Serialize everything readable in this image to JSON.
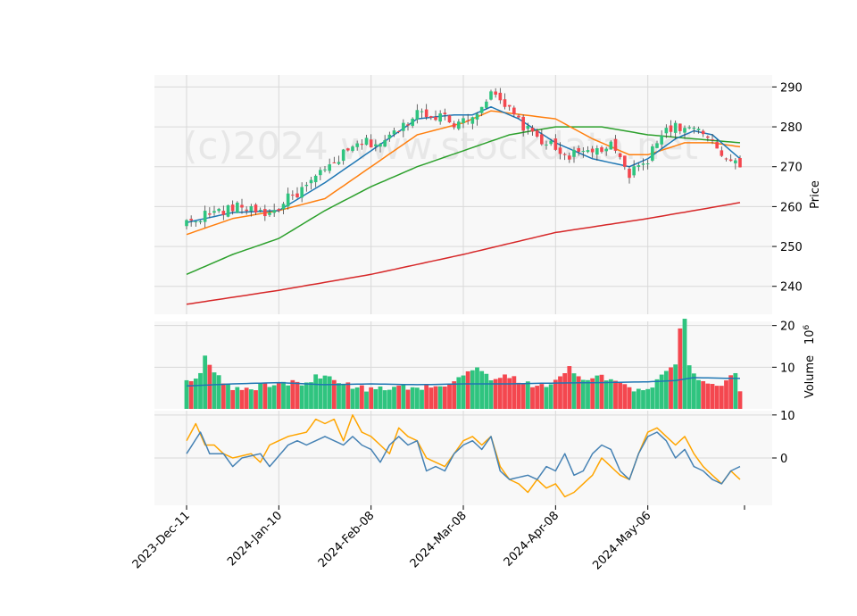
{
  "watermark": "(c)2024 www.stockdata.net",
  "colors": {
    "panel_bg": "#f8f8f8",
    "grid": "#d9d9d9",
    "up": "#2fc47f",
    "down": "#f4474f",
    "ma_short": "#1f77b4",
    "ma_mid": "#ff7f0e",
    "ma_long": "#2ca02c",
    "ma_200": "#d62728",
    "vol_ma": "#1f77b4",
    "osc_main": "#4682b4",
    "osc_signal": "#ffa500"
  },
  "chart_data": [
    {
      "type": "candlestick",
      "panel": "price",
      "ylabel": "Price",
      "ylim": [
        233,
        293
      ],
      "yticks": [
        "240",
        "250",
        "260",
        "270",
        "280",
        "290"
      ],
      "x_tick_labels": [
        "2023-Dec-11",
        "2024-Jan-10",
        "2024-Feb-08",
        "2024-Mar-08",
        "2024-Apr-08",
        "2024-May-06"
      ],
      "x_tick_positions": [
        0,
        20,
        40,
        60,
        80,
        100
      ],
      "n_bars": 121,
      "close_key": [
        [
          0,
          256
        ],
        [
          4,
          258
        ],
        [
          8,
          259
        ],
        [
          12,
          260
        ],
        [
          16,
          259
        ],
        [
          18,
          258
        ],
        [
          22,
          262
        ],
        [
          26,
          265
        ],
        [
          30,
          269
        ],
        [
          34,
          273
        ],
        [
          38,
          276
        ],
        [
          42,
          276
        ],
        [
          46,
          279
        ],
        [
          50,
          284
        ],
        [
          54,
          283
        ],
        [
          58,
          281
        ],
        [
          62,
          283
        ],
        [
          66,
          288
        ],
        [
          70,
          284
        ],
        [
          74,
          279
        ],
        [
          78,
          276
        ],
        [
          82,
          273
        ],
        [
          84,
          273
        ],
        [
          88,
          274
        ],
        [
          92,
          275
        ],
        [
          96,
          268
        ],
        [
          100,
          272
        ],
        [
          104,
          280
        ],
        [
          108,
          280
        ],
        [
          112,
          278
        ],
        [
          116,
          273
        ],
        [
          118,
          272
        ],
        [
          120,
          271
        ]
      ],
      "moving_averages": [
        {
          "period": "short",
          "key": [
            [
              0,
              256
            ],
            [
              10,
              258.5
            ],
            [
              20,
              259
            ],
            [
              30,
              266
            ],
            [
              40,
              274
            ],
            [
              50,
              282
            ],
            [
              58,
              283
            ],
            [
              62,
              283
            ],
            [
              66,
              285
            ],
            [
              72,
              282
            ],
            [
              80,
              276
            ],
            [
              88,
              272
            ],
            [
              96,
              270
            ],
            [
              100,
              272
            ],
            [
              106,
              277
            ],
            [
              110,
              279
            ],
            [
              114,
              278
            ],
            [
              118,
              274
            ],
            [
              120,
              272
            ]
          ]
        },
        {
          "period": "mid",
          "key": [
            [
              0,
              253
            ],
            [
              10,
              257
            ],
            [
              20,
              259
            ],
            [
              30,
              262
            ],
            [
              40,
              270
            ],
            [
              50,
              278
            ],
            [
              60,
              281
            ],
            [
              66,
              284
            ],
            [
              80,
              282
            ],
            [
              88,
              277
            ],
            [
              96,
              273
            ],
            [
              100,
              273
            ],
            [
              108,
              276
            ],
            [
              114,
              276
            ],
            [
              120,
              275
            ]
          ]
        },
        {
          "period": "long",
          "key": [
            [
              0,
              243
            ],
            [
              10,
              248
            ],
            [
              20,
              252
            ],
            [
              30,
              259
            ],
            [
              40,
              265
            ],
            [
              50,
              270
            ],
            [
              60,
              274
            ],
            [
              70,
              278
            ],
            [
              80,
              280
            ],
            [
              90,
              280
            ],
            [
              100,
              278
            ],
            [
              110,
              277
            ],
            [
              120,
              276
            ]
          ]
        },
        {
          "period": "200",
          "key": [
            [
              0,
              235.5
            ],
            [
              20,
              239
            ],
            [
              40,
              243
            ],
            [
              60,
              248
            ],
            [
              80,
              253.5
            ],
            [
              100,
              257
            ],
            [
              120,
              261
            ]
          ]
        }
      ]
    },
    {
      "type": "bar",
      "panel": "volume",
      "ylabel": "Volume",
      "yscale_label": "10^6",
      "ylim": [
        0,
        21
      ],
      "yticks": [
        "10",
        "20"
      ],
      "values_key": [
        [
          0,
          6.5
        ],
        [
          3,
          8
        ],
        [
          4,
          13.5
        ],
        [
          6,
          8.5
        ],
        [
          10,
          4.5
        ],
        [
          14,
          5
        ],
        [
          20,
          6
        ],
        [
          26,
          6.5
        ],
        [
          30,
          8.5
        ],
        [
          34,
          6
        ],
        [
          40,
          4.5
        ],
        [
          45,
          5.5
        ],
        [
          50,
          5
        ],
        [
          56,
          5.5
        ],
        [
          60,
          7.5
        ],
        [
          62,
          10
        ],
        [
          66,
          7
        ],
        [
          70,
          8
        ],
        [
          76,
          5
        ],
        [
          80,
          6.5
        ],
        [
          83,
          10
        ],
        [
          86,
          7.5
        ],
        [
          90,
          8
        ],
        [
          96,
          5
        ],
        [
          100,
          4
        ],
        [
          104,
          9
        ],
        [
          106,
          10.5
        ],
        [
          107,
          19
        ],
        [
          108,
          21
        ],
        [
          109,
          10
        ],
        [
          112,
          6
        ],
        [
          116,
          5.5
        ],
        [
          119,
          9
        ],
        [
          120,
          5
        ]
      ],
      "ma_key": [
        [
          0,
          5.5
        ],
        [
          10,
          6
        ],
        [
          20,
          6.3
        ],
        [
          30,
          5.8
        ],
        [
          40,
          6
        ],
        [
          50,
          5.8
        ],
        [
          60,
          6
        ],
        [
          70,
          6
        ],
        [
          80,
          6.2
        ],
        [
          90,
          6.3
        ],
        [
          100,
          6.5
        ],
        [
          106,
          6.8
        ],
        [
          110,
          7.5
        ],
        [
          120,
          7.3
        ]
      ]
    },
    {
      "type": "line",
      "panel": "oscillator",
      "ylim": [
        -11,
        11
      ],
      "yticks": [
        "0",
        "10"
      ],
      "series": [
        {
          "key": [
            [
              0,
              1
            ],
            [
              3,
              6
            ],
            [
              5,
              1
            ],
            [
              8,
              1
            ],
            [
              10,
              -2
            ],
            [
              12,
              0
            ],
            [
              16,
              1
            ],
            [
              18,
              -2
            ],
            [
              22,
              3
            ],
            [
              24,
              4
            ],
            [
              26,
              3
            ],
            [
              28,
              4
            ],
            [
              30,
              5
            ],
            [
              32,
              4
            ],
            [
              34,
              3
            ],
            [
              36,
              5
            ],
            [
              38,
              3
            ],
            [
              40,
              2
            ],
            [
              42,
              -1
            ],
            [
              44,
              3
            ],
            [
              46,
              5
            ],
            [
              48,
              3
            ],
            [
              50,
              4
            ],
            [
              52,
              -3
            ],
            [
              54,
              -2
            ],
            [
              56,
              -3
            ],
            [
              58,
              1
            ],
            [
              60,
              3
            ],
            [
              62,
              4
            ],
            [
              64,
              2
            ],
            [
              66,
              5
            ],
            [
              68,
              -3
            ],
            [
              70,
              -5
            ],
            [
              74,
              -4
            ],
            [
              76,
              -5
            ],
            [
              78,
              -2
            ],
            [
              80,
              -3
            ],
            [
              82,
              1
            ],
            [
              84,
              -4
            ],
            [
              86,
              -3
            ],
            [
              88,
              1
            ],
            [
              90,
              3
            ],
            [
              92,
              2
            ],
            [
              94,
              -3
            ],
            [
              96,
              -5
            ],
            [
              98,
              1
            ],
            [
              100,
              5
            ],
            [
              102,
              6
            ],
            [
              104,
              4
            ],
            [
              106,
              0
            ],
            [
              108,
              2
            ],
            [
              110,
              -2
            ],
            [
              112,
              -3
            ],
            [
              114,
              -5
            ],
            [
              116,
              -6
            ],
            [
              118,
              -3
            ],
            [
              120,
              -2
            ]
          ]
        },
        {
          "key": [
            [
              0,
              4
            ],
            [
              2,
              8
            ],
            [
              4,
              3
            ],
            [
              6,
              3
            ],
            [
              8,
              1
            ],
            [
              10,
              0
            ],
            [
              14,
              1
            ],
            [
              16,
              -1
            ],
            [
              18,
              3
            ],
            [
              20,
              4
            ],
            [
              22,
              5
            ],
            [
              26,
              6
            ],
            [
              28,
              9
            ],
            [
              30,
              8
            ],
            [
              32,
              9
            ],
            [
              34,
              4
            ],
            [
              36,
              10
            ],
            [
              38,
              6
            ],
            [
              40,
              5
            ],
            [
              42,
              3
            ],
            [
              44,
              1
            ],
            [
              46,
              7
            ],
            [
              48,
              5
            ],
            [
              50,
              4
            ],
            [
              52,
              0
            ],
            [
              54,
              -1
            ],
            [
              56,
              -2
            ],
            [
              58,
              1
            ],
            [
              60,
              4
            ],
            [
              62,
              5
            ],
            [
              64,
              3
            ],
            [
              66,
              5
            ],
            [
              68,
              -2
            ],
            [
              70,
              -5
            ],
            [
              72,
              -6
            ],
            [
              74,
              -8
            ],
            [
              76,
              -5
            ],
            [
              78,
              -7
            ],
            [
              80,
              -6
            ],
            [
              82,
              -9
            ],
            [
              84,
              -8
            ],
            [
              86,
              -6
            ],
            [
              88,
              -4
            ],
            [
              90,
              0
            ],
            [
              92,
              -2
            ],
            [
              94,
              -4
            ],
            [
              96,
              -5
            ],
            [
              98,
              1
            ],
            [
              100,
              6
            ],
            [
              102,
              7
            ],
            [
              104,
              5
            ],
            [
              106,
              3
            ],
            [
              108,
              5
            ],
            [
              110,
              1
            ],
            [
              112,
              -2
            ],
            [
              114,
              -4
            ],
            [
              116,
              -6
            ],
            [
              118,
              -3
            ],
            [
              120,
              -5
            ]
          ]
        }
      ]
    }
  ]
}
